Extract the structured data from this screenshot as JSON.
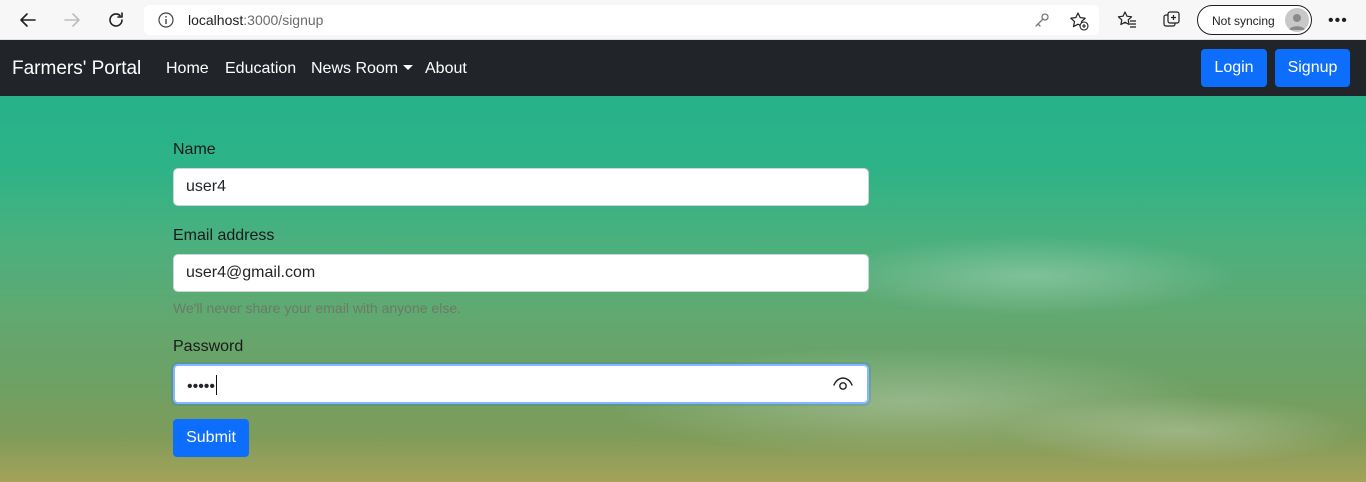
{
  "browser": {
    "url_host": "localhost",
    "url_rest": ":3000/signup",
    "sync_label": "Not syncing",
    "icons": [
      "back-icon",
      "forward-icon",
      "refresh-icon",
      "info-icon",
      "key-icon",
      "add-favorite-icon",
      "favorites-icon",
      "collections-icon",
      "profile-icon",
      "more-icon"
    ]
  },
  "navbar": {
    "brand": "Farmers' Portal",
    "links": [
      "Home",
      "Education",
      "News Room",
      "About"
    ],
    "login_label": "Login",
    "signup_label": "Signup",
    "bg_color": "#212529",
    "accent_color": "#0d6efd"
  },
  "form": {
    "name_label": "Name",
    "name_value": "user4",
    "email_label": "Email address",
    "email_value": "user4@gmail.com",
    "email_help": "We'll never share your email with anyone else.",
    "password_label": "Password",
    "password_value": "•••••",
    "submit_label": "Submit"
  }
}
